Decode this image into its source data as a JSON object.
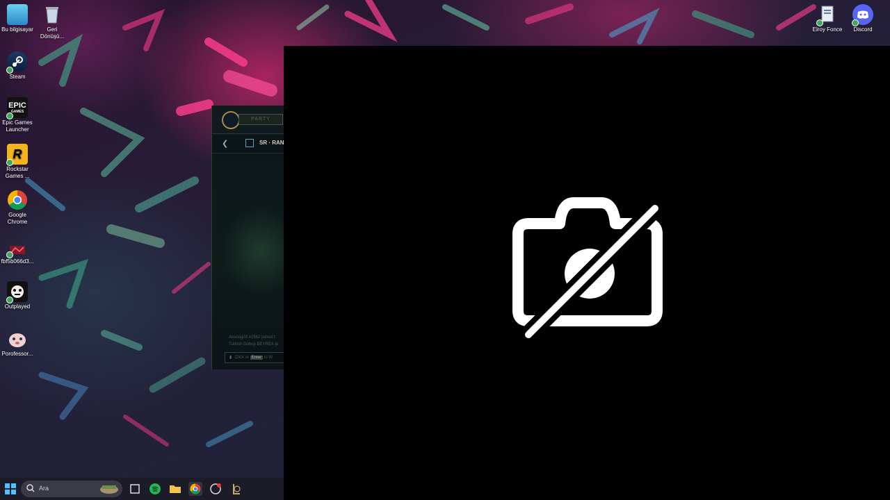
{
  "desktop": {
    "left_icons": [
      {
        "label": "Bu bilgisayar"
      },
      {
        "label": "Geri Dönüşü..."
      },
      {
        "label": "Steam"
      },
      {
        "label": "Epic Games Launcher"
      },
      {
        "label": "Rockstar Games ..."
      },
      {
        "label": "Google Chrome"
      },
      {
        "label": "fbf5b066d3..."
      },
      {
        "label": "Outplayed"
      },
      {
        "label": "Porofessor..."
      }
    ],
    "right_icons": [
      {
        "label": "Elroy Fonce"
      },
      {
        "label": "Discord"
      }
    ],
    "epic_icon_text": "EPIC",
    "epic_icon_subtext": "GAMES",
    "rockstar_icon_text": "R"
  },
  "lol_client": {
    "party_label": "PARTY",
    "mode_label": "SR · RAN",
    "chat_lines": [
      "Amolog03 #2562 joined t",
      "Turkish Dobup BEYREX jo"
    ],
    "chat_input_prefix": "Click or",
    "chat_input_key": "Enter",
    "chat_input_suffix": "to W"
  },
  "webcam": {
    "status_icon": "camera-off-icon"
  },
  "taskbar": {
    "search_placeholder": "Ara",
    "pinned_icons": [
      "windows-start-icon",
      "task-view-icon",
      "spotify-icon",
      "file-explorer-icon",
      "chrome-icon",
      "outplayed-icon",
      "league-client-icon"
    ]
  },
  "colors": {
    "camera_panel": "#000000",
    "spotify": "#1db954",
    "discord": "#5865f2"
  }
}
